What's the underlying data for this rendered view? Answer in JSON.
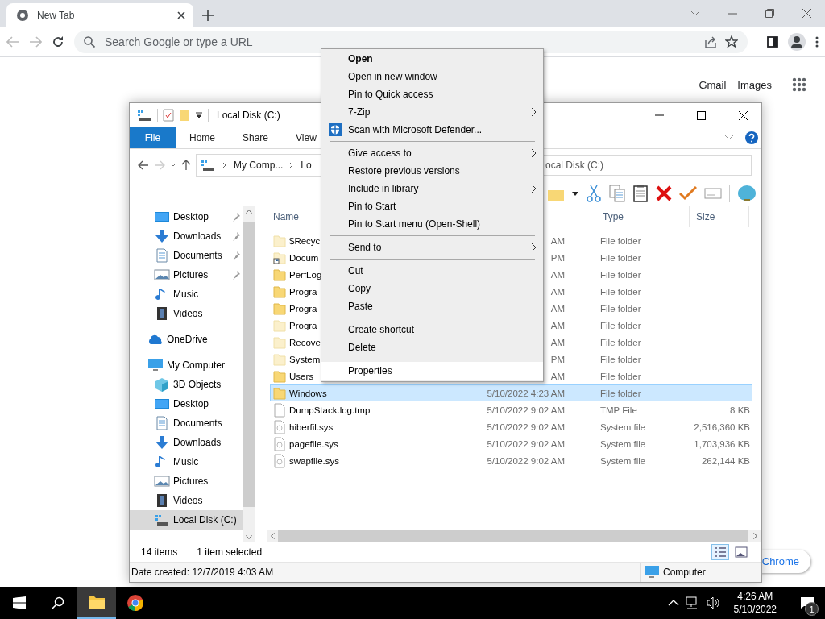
{
  "browser": {
    "tab": {
      "title": "New Tab"
    },
    "omnibox": {
      "placeholder": "Search Google or type a URL"
    },
    "links": [
      "Gmail",
      "Images"
    ],
    "customize": "Chrome"
  },
  "explorer": {
    "title": "Local Disk (C:)",
    "ribbon_tabs": [
      {
        "label": "File",
        "kind": "file"
      },
      {
        "label": "Home",
        "kind": "tab"
      },
      {
        "label": "Share",
        "kind": "tab"
      },
      {
        "label": "View",
        "kind": "tab"
      }
    ],
    "address": [
      "My Comp...",
      "Lo"
    ],
    "search": {
      "placeholder": "ocal Disk (C:)"
    },
    "quick_access": [
      {
        "label": "Desktop",
        "kind": "desktop",
        "pinned": true
      },
      {
        "label": "Downloads",
        "kind": "downloads",
        "pinned": true
      },
      {
        "label": "Documents",
        "kind": "documents",
        "pinned": true
      },
      {
        "label": "Pictures",
        "kind": "pictures",
        "pinned": true
      },
      {
        "label": "Music",
        "kind": "music",
        "pinned": false
      },
      {
        "label": "Videos",
        "kind": "videos",
        "pinned": false
      }
    ],
    "tree": [
      {
        "label": "OneDrive",
        "kind": "cloud",
        "selected": false
      },
      {
        "label": "My Computer",
        "kind": "pc",
        "selected": false,
        "children": [
          {
            "label": "3D Objects",
            "kind": "cube",
            "selected": false
          },
          {
            "label": "Desktop",
            "kind": "desktop",
            "selected": false
          },
          {
            "label": "Documents",
            "kind": "documents",
            "selected": false
          },
          {
            "label": "Downloads",
            "kind": "downloads",
            "selected": false
          },
          {
            "label": "Music",
            "kind": "music",
            "selected": false
          },
          {
            "label": "Pictures",
            "kind": "pictures",
            "selected": false
          },
          {
            "label": "Videos",
            "kind": "videos",
            "selected": false
          },
          {
            "label": "Local Disk (C:)",
            "kind": "drive",
            "selected": true
          }
        ]
      }
    ],
    "columns": {
      "name": "Name",
      "type": "Type",
      "size": "Size"
    },
    "rows": [
      {
        "kind": "hidden-folder",
        "name": "$Recyc",
        "date": "AM",
        "type": "File folder",
        "selected": false
      },
      {
        "kind": "shortcut",
        "name": "Docum",
        "date": "PM",
        "type": "File folder",
        "selected": false
      },
      {
        "kind": "folder",
        "name": "PerfLog",
        "date": "AM",
        "type": "File folder",
        "selected": false
      },
      {
        "kind": "folder",
        "name": "Progra",
        "date": "AM",
        "type": "File folder",
        "selected": false
      },
      {
        "kind": "folder",
        "name": "Progra",
        "date": "AM",
        "type": "File folder",
        "selected": false
      },
      {
        "kind": "hidden-folder",
        "name": "Progra",
        "date": "AM",
        "type": "File folder",
        "selected": false
      },
      {
        "kind": "hidden-folder",
        "name": "Recove",
        "date": "AM",
        "type": "File folder",
        "selected": false
      },
      {
        "kind": "hidden-folder",
        "name": "System",
        "date": "PM",
        "type": "File folder",
        "selected": false
      },
      {
        "kind": "folder",
        "name": "Users",
        "date": "AM",
        "type": "File folder",
        "selected": false
      },
      {
        "kind": "folder",
        "name": "Windows",
        "date": "5/10/2022 4:23 AM",
        "type": "File folder",
        "selected": true
      },
      {
        "kind": "file",
        "name": "DumpStack.log.tmp",
        "date": "5/10/2022 9:02 AM",
        "type": "TMP File",
        "size": "8 KB",
        "selected": false
      },
      {
        "kind": "system-file",
        "name": "hiberfil.sys",
        "date": "5/10/2022 9:02 AM",
        "type": "System file",
        "size": "2,516,360 KB",
        "selected": false
      },
      {
        "kind": "system-file",
        "name": "pagefile.sys",
        "date": "5/10/2022 9:02 AM",
        "type": "System file",
        "size": "1,703,936 KB",
        "selected": false
      },
      {
        "kind": "system-file",
        "name": "swapfile.sys",
        "date": "5/10/2022 9:02 AM",
        "type": "System file",
        "size": "262,144 KB",
        "selected": false
      }
    ],
    "status": {
      "count": "14 items",
      "selection": "1 item selected"
    },
    "details": {
      "text": "Date created: 12/7/2019 4:03 AM",
      "location": "Computer"
    }
  },
  "menu": [
    {
      "kind": "item",
      "label": "Open",
      "default": true,
      "submenu": false,
      "hovered": false
    },
    {
      "kind": "item",
      "label": "Open in new window",
      "default": false,
      "submenu": false,
      "hovered": false
    },
    {
      "kind": "item",
      "label": "Pin to Quick access",
      "default": false,
      "submenu": false,
      "hovered": false
    },
    {
      "kind": "item",
      "label": "7-Zip",
      "default": false,
      "submenu": true,
      "hovered": false
    },
    {
      "kind": "shield-item",
      "label": "Scan with Microsoft Defender...",
      "default": false,
      "submenu": false,
      "hovered": false
    },
    {
      "kind": "separator"
    },
    {
      "kind": "item",
      "label": "Give access to",
      "default": false,
      "submenu": true,
      "hovered": false
    },
    {
      "kind": "item",
      "label": "Restore previous versions",
      "default": false,
      "submenu": false,
      "hovered": false
    },
    {
      "kind": "item",
      "label": "Include in library",
      "default": false,
      "submenu": true,
      "hovered": false
    },
    {
      "kind": "item",
      "label": "Pin to Start",
      "default": false,
      "submenu": false,
      "hovered": false
    },
    {
      "kind": "item",
      "label": "Pin to Start menu (Open-Shell)",
      "default": false,
      "submenu": false,
      "hovered": false
    },
    {
      "kind": "separator"
    },
    {
      "kind": "item",
      "label": "Send to",
      "default": false,
      "submenu": true,
      "hovered": false
    },
    {
      "kind": "separator"
    },
    {
      "kind": "item",
      "label": "Cut",
      "default": false,
      "submenu": false,
      "hovered": false
    },
    {
      "kind": "item",
      "label": "Copy",
      "default": false,
      "submenu": false,
      "hovered": false
    },
    {
      "kind": "item",
      "label": "Paste",
      "default": false,
      "submenu": false,
      "hovered": false
    },
    {
      "kind": "separator"
    },
    {
      "kind": "item",
      "label": "Create shortcut",
      "default": false,
      "submenu": false,
      "hovered": false
    },
    {
      "kind": "item",
      "label": "Delete",
      "default": false,
      "submenu": false,
      "hovered": false
    },
    {
      "kind": "separator"
    },
    {
      "kind": "item",
      "label": "Properties",
      "default": false,
      "submenu": false,
      "hovered": true
    }
  ],
  "taskbar": {
    "apps": [
      {
        "kind": "explorer",
        "active": true
      },
      {
        "kind": "chrome",
        "active": false
      }
    ],
    "time": "4:26 AM",
    "date": "5/10/2022",
    "notifications": "1"
  }
}
